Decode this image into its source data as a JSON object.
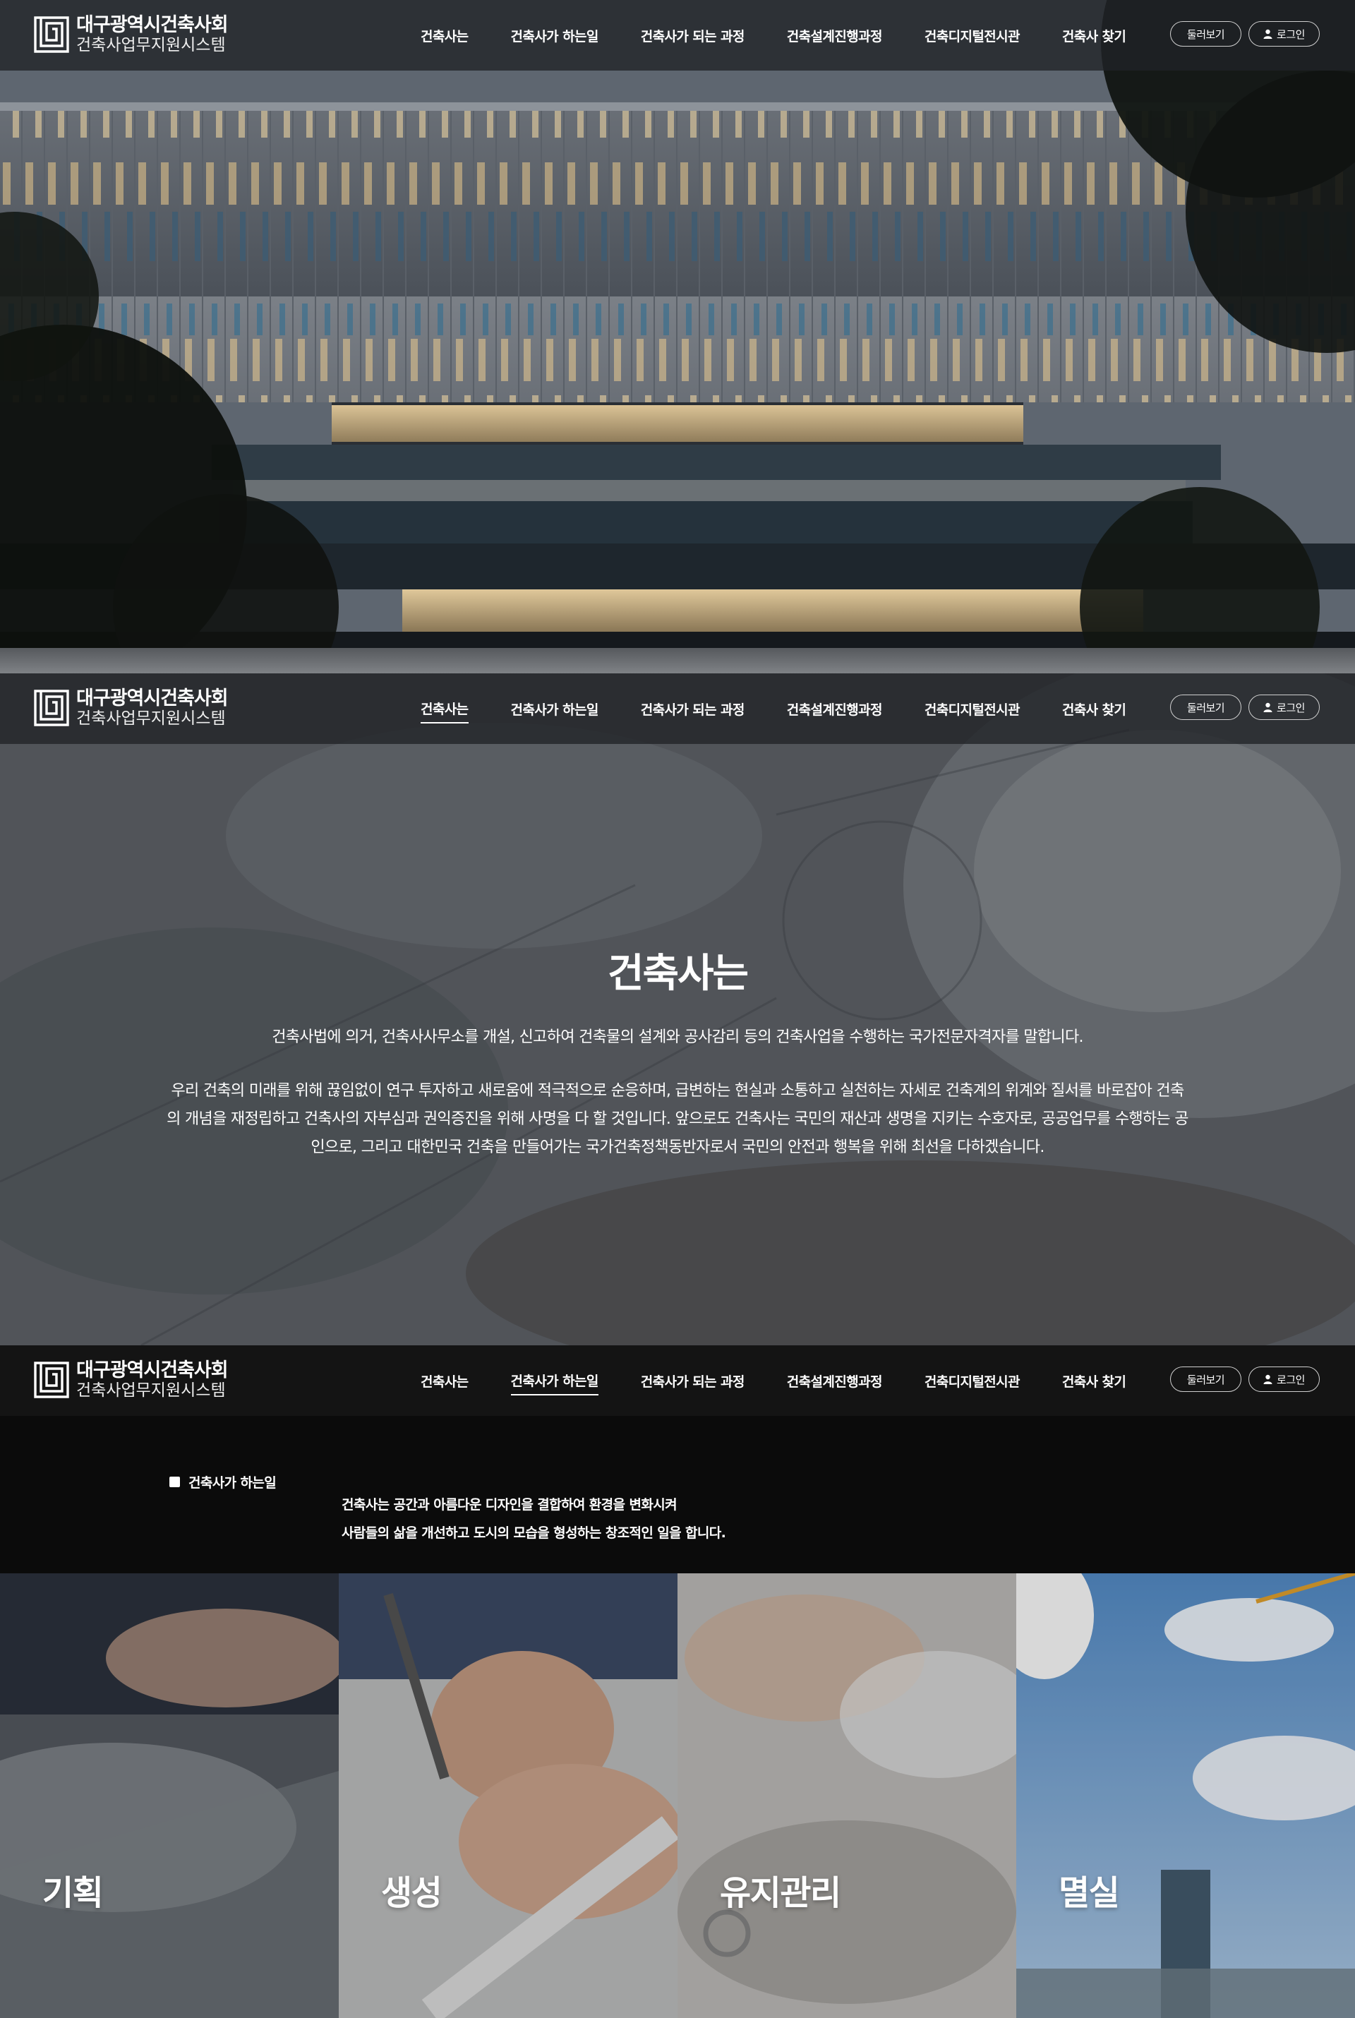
{
  "header": {
    "logo_main": "대구광역시건축사회",
    "logo_sub": "건축사업무지원시스템",
    "nav": [
      {
        "label": "건축사는"
      },
      {
        "label": "건축사가 하는일"
      },
      {
        "label": "건축사가 되는 과정"
      },
      {
        "label": "건축설계진행과정"
      },
      {
        "label": "건축디지털전시관"
      },
      {
        "label": "건축사 찾기"
      }
    ],
    "tour_label": "둘러보기",
    "login_label": "로그인"
  },
  "intro": {
    "title": "건축사는",
    "lead": "건축사법에 의거, 건축사사무소를 개설, 신고하여 건축물의 설계와 공사감리 등의 건축사업을 수행하는 국가전문자격자를 말합니다.",
    "body": "우리 건축의 미래를 위해 끊임없이 연구 투자하고 새로움에 적극적으로 순응하며, 급변하는 현실과 소통하고 실천하는 자세로 건축계의 위계와 질서를 바로잡아 건축의 개념을 재정립하고 건축사의 자부심과 권익증진을 위해 사명을 다 할 것입니다. 앞으로도 건축사는 국민의 재산과 생명을 지키는 수호자로, 공공업무를 수행하는 공인으로, 그리고 대한민국 건축을 만들어가는 국가건축정책동반자로서 국민의 안전과 행복을 위해 최선을 다하겠습니다."
  },
  "work": {
    "tag": "건축사가 하는일",
    "desc_line1": "건축사는 공간과 아름다운 디자인을 결합하여 환경을 변화시켜",
    "desc_line2": "사람들의 삶을 개선하고 도시의 모습을 형성하는 창조적인 일을 합니다.",
    "cards": [
      {
        "label": "기획"
      },
      {
        "label": "생성"
      },
      {
        "label": "유지관리"
      },
      {
        "label": "멸실"
      }
    ]
  },
  "colors": {
    "header_overlay": "#202226",
    "header_dark": "#141414",
    "work_bg": "#0b0b0b",
    "sky_blue": "#4f86c0"
  }
}
